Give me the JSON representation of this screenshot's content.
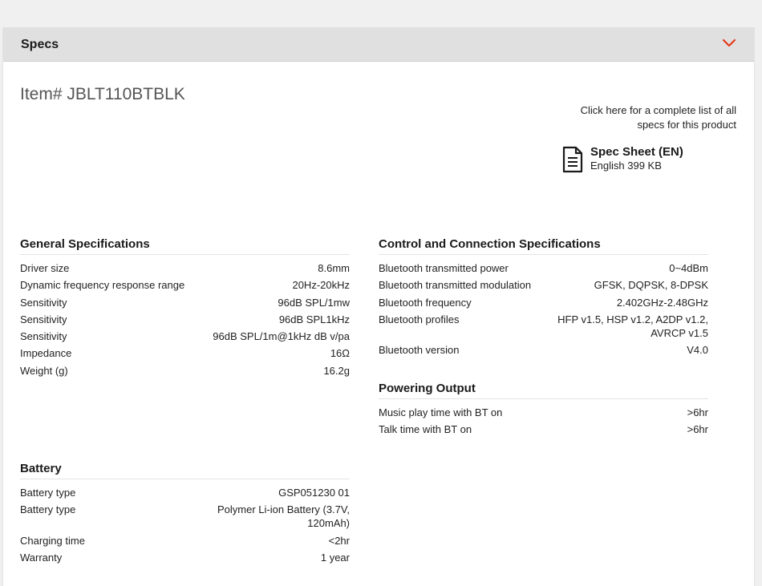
{
  "header": {
    "title": "Specs",
    "chevron_icon": "chevron-down-icon",
    "accent": "#e53b1c"
  },
  "item_number": "Item# JBLT110BTBLK",
  "spec_link": "Click here for a complete list of all specs for this product",
  "spec_sheet": {
    "icon": "document-icon",
    "title": "Spec Sheet (EN)",
    "subtitle": "English 399 KB"
  },
  "general": {
    "title": "General Specifications",
    "rows": [
      {
        "label": "Driver size",
        "value": "8.6mm"
      },
      {
        "label": "Dynamic frequency response range",
        "value": "20Hz-20kHz"
      },
      {
        "label": "Sensitivity",
        "value": "96dB SPL/1mw"
      },
      {
        "label": "Sensitivity",
        "value": "96dB SPL1kHz"
      },
      {
        "label": "Sensitivity",
        "value": "96dB SPL/1m@1kHz dB v/pa"
      },
      {
        "label": "Impedance",
        "value": "16Ω"
      },
      {
        "label": "Weight (g)",
        "value": "16.2g"
      }
    ]
  },
  "battery": {
    "title": "Battery",
    "rows": [
      {
        "label": "Battery type",
        "value": "GSP051230 01"
      },
      {
        "label": "Battery type",
        "value": "Polymer Li-ion Battery (3.7V, 120mAh)"
      },
      {
        "label": "Charging time",
        "value": "<2hr"
      },
      {
        "label": "Warranty",
        "value": "1 year"
      }
    ]
  },
  "control": {
    "title": "Control and Connection Specifications",
    "rows": [
      {
        "label": "Bluetooth transmitted power",
        "value": "0~4dBm"
      },
      {
        "label": "Bluetooth transmitted modulation",
        "value": "GFSK, DQPSK, 8-DPSK"
      },
      {
        "label": "Bluetooth frequency",
        "value": "2.402GHz-2.48GHz"
      },
      {
        "label": "Bluetooth profiles",
        "value": "HFP v1.5, HSP v1.2, A2DP v1.2, AVRCP v1.5"
      },
      {
        "label": "Bluetooth version",
        "value": "V4.0"
      }
    ]
  },
  "powering": {
    "title": "Powering Output",
    "rows": [
      {
        "label": "Music play time with BT on",
        "value": ">6hr"
      },
      {
        "label": "Talk time with BT on",
        "value": ">6hr"
      }
    ]
  }
}
